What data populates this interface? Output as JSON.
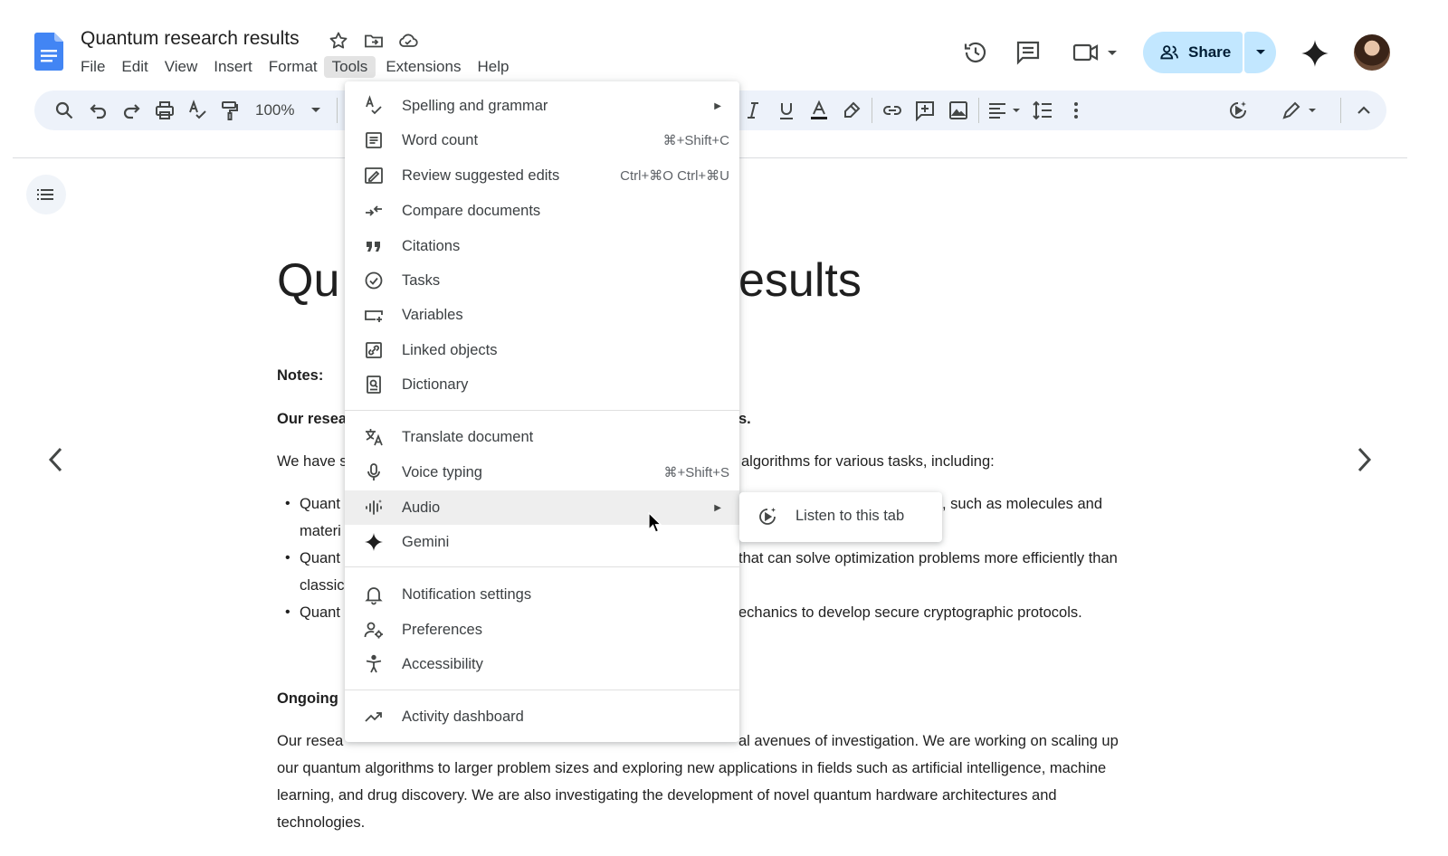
{
  "app": {
    "doc_title": "Quantum research results"
  },
  "menubar": {
    "items": [
      {
        "label": "File"
      },
      {
        "label": "Edit"
      },
      {
        "label": "View"
      },
      {
        "label": "Insert"
      },
      {
        "label": "Format"
      },
      {
        "label": "Tools"
      },
      {
        "label": "Extensions"
      },
      {
        "label": "Help"
      }
    ],
    "active": "Tools"
  },
  "header": {
    "share_label": "Share"
  },
  "toolbar": {
    "zoom": "100%"
  },
  "tools_menu": {
    "items": [
      {
        "label": "Spelling and grammar",
        "shortcut": "",
        "icon": "spellcheck-icon",
        "submenu": true
      },
      {
        "label": "Word count",
        "shortcut": "⌘+Shift+C",
        "icon": "word-count-icon"
      },
      {
        "label": "Review suggested edits",
        "shortcut": "Ctrl+⌘O Ctrl+⌘U",
        "icon": "review-edits-icon"
      },
      {
        "label": "Compare documents",
        "shortcut": "",
        "icon": "compare-icon"
      },
      {
        "label": "Citations",
        "shortcut": "",
        "icon": "quote-icon"
      },
      {
        "label": "Tasks",
        "shortcut": "",
        "icon": "check-circle-icon"
      },
      {
        "label": "Variables",
        "shortcut": "",
        "icon": "variables-icon"
      },
      {
        "label": "Linked objects",
        "shortcut": "",
        "icon": "linked-objects-icon"
      },
      {
        "label": "Dictionary",
        "shortcut": "",
        "icon": "dictionary-icon"
      },
      {
        "label": "Translate document",
        "shortcut": "",
        "icon": "translate-icon"
      },
      {
        "label": "Voice typing",
        "shortcut": "⌘+Shift+S",
        "icon": "microphone-icon"
      },
      {
        "label": "Audio",
        "shortcut": "",
        "icon": "audio-icon",
        "submenu": true,
        "hovered": true
      },
      {
        "label": "Gemini",
        "shortcut": "",
        "icon": "gemini-sparkle-icon"
      },
      {
        "label": "Notification settings",
        "shortcut": "",
        "icon": "bell-icon"
      },
      {
        "label": "Preferences",
        "shortcut": "",
        "icon": "preferences-icon"
      },
      {
        "label": "Accessibility",
        "shortcut": "",
        "icon": "accessibility-icon"
      },
      {
        "label": "Activity dashboard",
        "shortcut": "",
        "icon": "trending-up-icon"
      }
    ]
  },
  "audio_submenu": {
    "items": [
      {
        "label": "Listen to this tab",
        "icon": "play-circle-icon"
      }
    ]
  },
  "document": {
    "heading_left": "Qu",
    "heading_right": "esults",
    "notes_label": "Notes:",
    "para1_left": "Our resea",
    "para1_right": "s.",
    "para2_left": "We have s",
    "para2_right": "algorithms for various tasks, including:",
    "bullet1_left": "Quant",
    "bullet1_right": ", such as molecules and",
    "bullet1_cont": "materi",
    "bullet2_left": "Quant",
    "bullet2_right": "that can solve optimization problems more efficiently than",
    "bullet2_cont": "classic",
    "bullet3_left": "Quant",
    "bullet3_right": "echanics to develop secure cryptographic protocols.",
    "ongoing_label": "Ongoing",
    "para3_line1_left": "Our resea",
    "para3_line1_right": "al avenues of investigation. We are working on scaling up",
    "para3_line2": "our quantum algorithms to larger problem sizes and exploring new applications in fields such as artificial intelligence, machine",
    "para3_line3": "learning, and drug discovery. We are also investigating the development of novel quantum hardware architectures and",
    "para3_line4": "technologies."
  },
  "colors": {
    "share_bg": "#c2e7ff",
    "toolbar_bg": "#edf2fa",
    "docs_blue": "#4285f4",
    "menu_hover": "#eeeeee"
  }
}
